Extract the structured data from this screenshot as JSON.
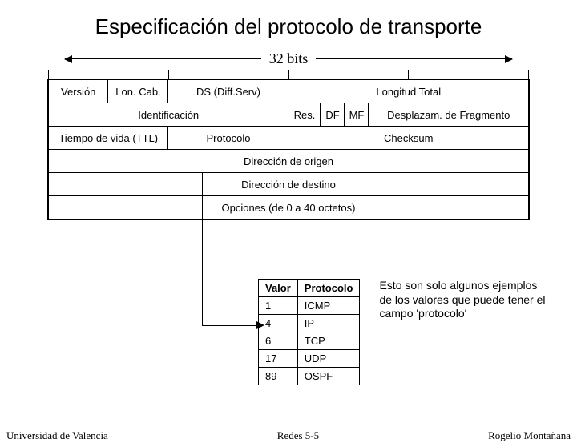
{
  "title": "Especificación del protocolo de transporte",
  "bits_label": "32 bits",
  "header_rows": {
    "r1": {
      "version": "Versión",
      "loncab": "Lon. Cab.",
      "ds": "DS (Diff.Serv)",
      "longtotal": "Longitud Total"
    },
    "r2": {
      "ident": "Identificación",
      "res": "Res.",
      "df": "DF",
      "mf": "MF",
      "frag": "Desplazam. de Fragmento"
    },
    "r3": {
      "ttl": "Tiempo de vida (TTL)",
      "proto": "Protocolo",
      "checksum": "Checksum"
    },
    "r4": {
      "src": "Dirección de origen"
    },
    "r5": {
      "dst": "Dirección de destino"
    },
    "r6": {
      "opt": "Opciones (de 0 a 40 octetos)"
    }
  },
  "proto_table": {
    "headers": {
      "valor": "Valor",
      "protocolo": "Protocolo"
    },
    "rows": [
      {
        "valor": "1",
        "protocolo": "ICMP"
      },
      {
        "valor": "4",
        "protocolo": "IP"
      },
      {
        "valor": "6",
        "protocolo": "TCP"
      },
      {
        "valor": "17",
        "protocolo": "UDP"
      },
      {
        "valor": "89",
        "protocolo": "OSPF"
      }
    ]
  },
  "note": "Esto son solo algunos ejemplos de los valores que puede tener el campo 'protocolo'",
  "footer": {
    "left": "Universidad de Valencia",
    "center": "Redes 5-5",
    "right": "Rogelio Montañana"
  }
}
